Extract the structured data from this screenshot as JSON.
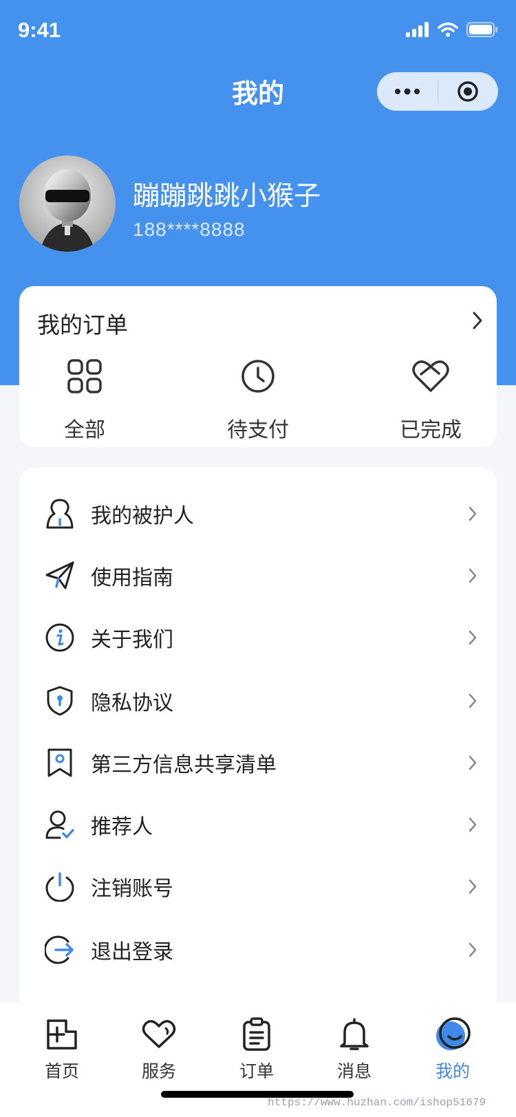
{
  "status_bar": {
    "time": "9:41"
  },
  "nav": {
    "title": "我的",
    "more_icon": "more-dots-icon",
    "close_icon": "target-close-icon"
  },
  "profile": {
    "username": "蹦蹦跳跳小猴子",
    "phone": "188****8888"
  },
  "orders": {
    "title": "我的订单",
    "items": [
      {
        "label": "全部",
        "icon": "grid-icon"
      },
      {
        "label": "待支付",
        "icon": "clock-icon"
      },
      {
        "label": "已完成",
        "icon": "heart-handshake-icon"
      }
    ]
  },
  "menu": {
    "items": [
      {
        "label": "我的被护人",
        "icon": "person-icon"
      },
      {
        "label": "使用指南",
        "icon": "paper-plane-icon"
      },
      {
        "label": "关于我们",
        "icon": "info-icon"
      },
      {
        "label": "隐私协议",
        "icon": "shield-lock-icon"
      },
      {
        "label": "第三方信息共享清单",
        "icon": "bookmark-user-icon"
      },
      {
        "label": "推荐人",
        "icon": "user-check-icon"
      },
      {
        "label": "注销账号",
        "icon": "power-icon"
      },
      {
        "label": "退出登录",
        "icon": "logout-icon"
      }
    ]
  },
  "tabbar": {
    "items": [
      {
        "label": "首页",
        "icon": "home-plus-icon"
      },
      {
        "label": "服务",
        "icon": "heart-icon"
      },
      {
        "label": "订单",
        "icon": "clipboard-icon"
      },
      {
        "label": "消息",
        "icon": "bell-icon"
      },
      {
        "label": "我的",
        "icon": "smile-icon",
        "active": true
      }
    ]
  },
  "watermark": "https://www.huzhan.com/ishop51679",
  "colors": {
    "primary": "#4591ee",
    "active_tab": "#3f8ae8",
    "background": "#f4f6fa"
  }
}
